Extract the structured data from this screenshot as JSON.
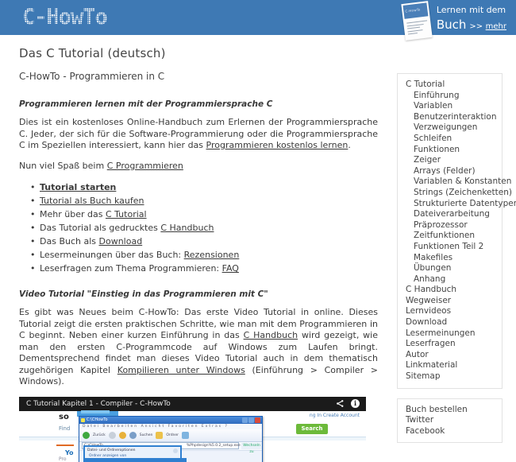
{
  "header": {
    "logo": "C-HowTo",
    "promo_line1": "Lernen mit dem",
    "promo_buch": "Buch",
    "promo_arrows": ">>",
    "promo_mehr": "mehr",
    "book_cover_title": "C-HowTo",
    "brand_color": "#3e79b4"
  },
  "main": {
    "title": "Das C Tutorial (deutsch)",
    "subtitle": "C-HowTo - Programmieren in C",
    "section1_heading": "Programmieren lernen mit der Programmiersprache C",
    "para1_a": "Dies ist ein kostenloses Online-Handbuch zum Erlernen der Programmiersprache C. Jeder, der sich für die Software-Programmierung oder die Programmiersprache C im Speziellen interessiert, kann hier das ",
    "para1_link": "Programmieren kostenlos lernen",
    "para1_b": ".",
    "para2_a": "Nun viel Spaß beim ",
    "para2_link": "C Programmieren",
    "list": [
      {
        "pre": "",
        "link": "Tutorial starten",
        "post": "",
        "bold": true
      },
      {
        "pre": "",
        "link": "Tutorial als Buch kaufen",
        "post": "",
        "bold": false
      },
      {
        "pre": "Mehr über das ",
        "link": "C Tutorial",
        "post": "",
        "bold": false
      },
      {
        "pre": "Das Tutorial als gedrucktes ",
        "link": "C Handbuch",
        "post": "",
        "bold": false
      },
      {
        "pre": "Das Buch als ",
        "link": "Download",
        "post": "",
        "bold": false
      },
      {
        "pre": "Lesermeinungen über das Buch: ",
        "link": "Rezensionen",
        "post": "",
        "bold": false
      },
      {
        "pre": "Leserfragen zum Thema Programmieren: ",
        "link": "FAQ",
        "post": "",
        "bold": false
      }
    ],
    "section2_heading": "Video Tutorial \"Einstieg in das Programmieren mit C\"",
    "para3_a": "Es gibt was Neues beim C-HowTo: Das erste Video Tutorial in online. Dieses Tutorial zeigt die ersten praktischen Schritte, wie man mit dem Programmieren in C beginnt. Neben einer kurzen Einführung in das ",
    "para3_link1": "C Handbuch",
    "para3_b": " wird gezeigt, wie man den ersten C-Programmcode auf Windows zum Laufen bringt. Dementsprechend findet man dieses Video Tutorial auch in dem thematisch zugehörigen Kapitel ",
    "para3_link2": "Kompilieren unter Windows",
    "para3_c": " (Einführung > Compiler > Windows)."
  },
  "video": {
    "title": "C Tutorial Kapitel 1 - Compiler - C-HowTo",
    "share_icon": "share-icon",
    "info_icon": "info-icon",
    "overlay": {
      "so_label": "so",
      "find_label": "Find",
      "search_button": "Search",
      "nav_right": "ng In   Create Account",
      "yo_label": "Yo",
      "small_label": "Pro",
      "xp_window_title": "C:\\CHowTo",
      "xp_menu": "Datei  Bearbeiten  Ansicht  Favoriten  Extras  ?",
      "xp_back": "Zurück",
      "xp_search": "Suchen",
      "xp_folders": "Ordner",
      "xp_address": "C:\\CHowTo",
      "xp_go": "Wechseln zu",
      "xp_dialog_title": "Datei- und Ordneroptionen",
      "xp_dialog_row": "Ordner anzeigen von",
      "xp_file": "%Phpdesign%5.0.2_setup.exe"
    }
  },
  "sidebar": {
    "box1": [
      {
        "label": "C Tutorial",
        "indent": false
      },
      {
        "label": "Einführung",
        "indent": true
      },
      {
        "label": "Variablen",
        "indent": true
      },
      {
        "label": "Benutzerinteraktion",
        "indent": true
      },
      {
        "label": "Verzweigungen",
        "indent": true
      },
      {
        "label": "Schleifen",
        "indent": true
      },
      {
        "label": "Funktionen",
        "indent": true
      },
      {
        "label": "Zeiger",
        "indent": true
      },
      {
        "label": "Arrays (Felder)",
        "indent": true
      },
      {
        "label": "Variablen & Konstanten",
        "indent": true
      },
      {
        "label": "Strings (Zeichenketten)",
        "indent": true
      },
      {
        "label": "Strukturierte Datentypen",
        "indent": true
      },
      {
        "label": "Dateiverarbeitung",
        "indent": true
      },
      {
        "label": "Präprozessor",
        "indent": true
      },
      {
        "label": "Zeitfunktionen",
        "indent": true
      },
      {
        "label": "Funktionen Teil 2",
        "indent": true
      },
      {
        "label": "Makefiles",
        "indent": true
      },
      {
        "label": "Übungen",
        "indent": true
      },
      {
        "label": "Anhang",
        "indent": true
      },
      {
        "label": "C Handbuch",
        "indent": false
      },
      {
        "label": "Wegweiser",
        "indent": false
      },
      {
        "label": "Lernvideos",
        "indent": false
      },
      {
        "label": "Download",
        "indent": false
      },
      {
        "label": "Lesermeinungen",
        "indent": false
      },
      {
        "label": "Leserfragen",
        "indent": false
      },
      {
        "label": "Autor",
        "indent": false
      },
      {
        "label": "Linkmaterial",
        "indent": false
      },
      {
        "label": "Sitemap",
        "indent": false
      }
    ],
    "box2": [
      {
        "label": "Buch bestellen",
        "indent": false
      },
      {
        "label": "Twitter",
        "indent": false
      },
      {
        "label": "Facebook",
        "indent": false
      }
    ]
  }
}
